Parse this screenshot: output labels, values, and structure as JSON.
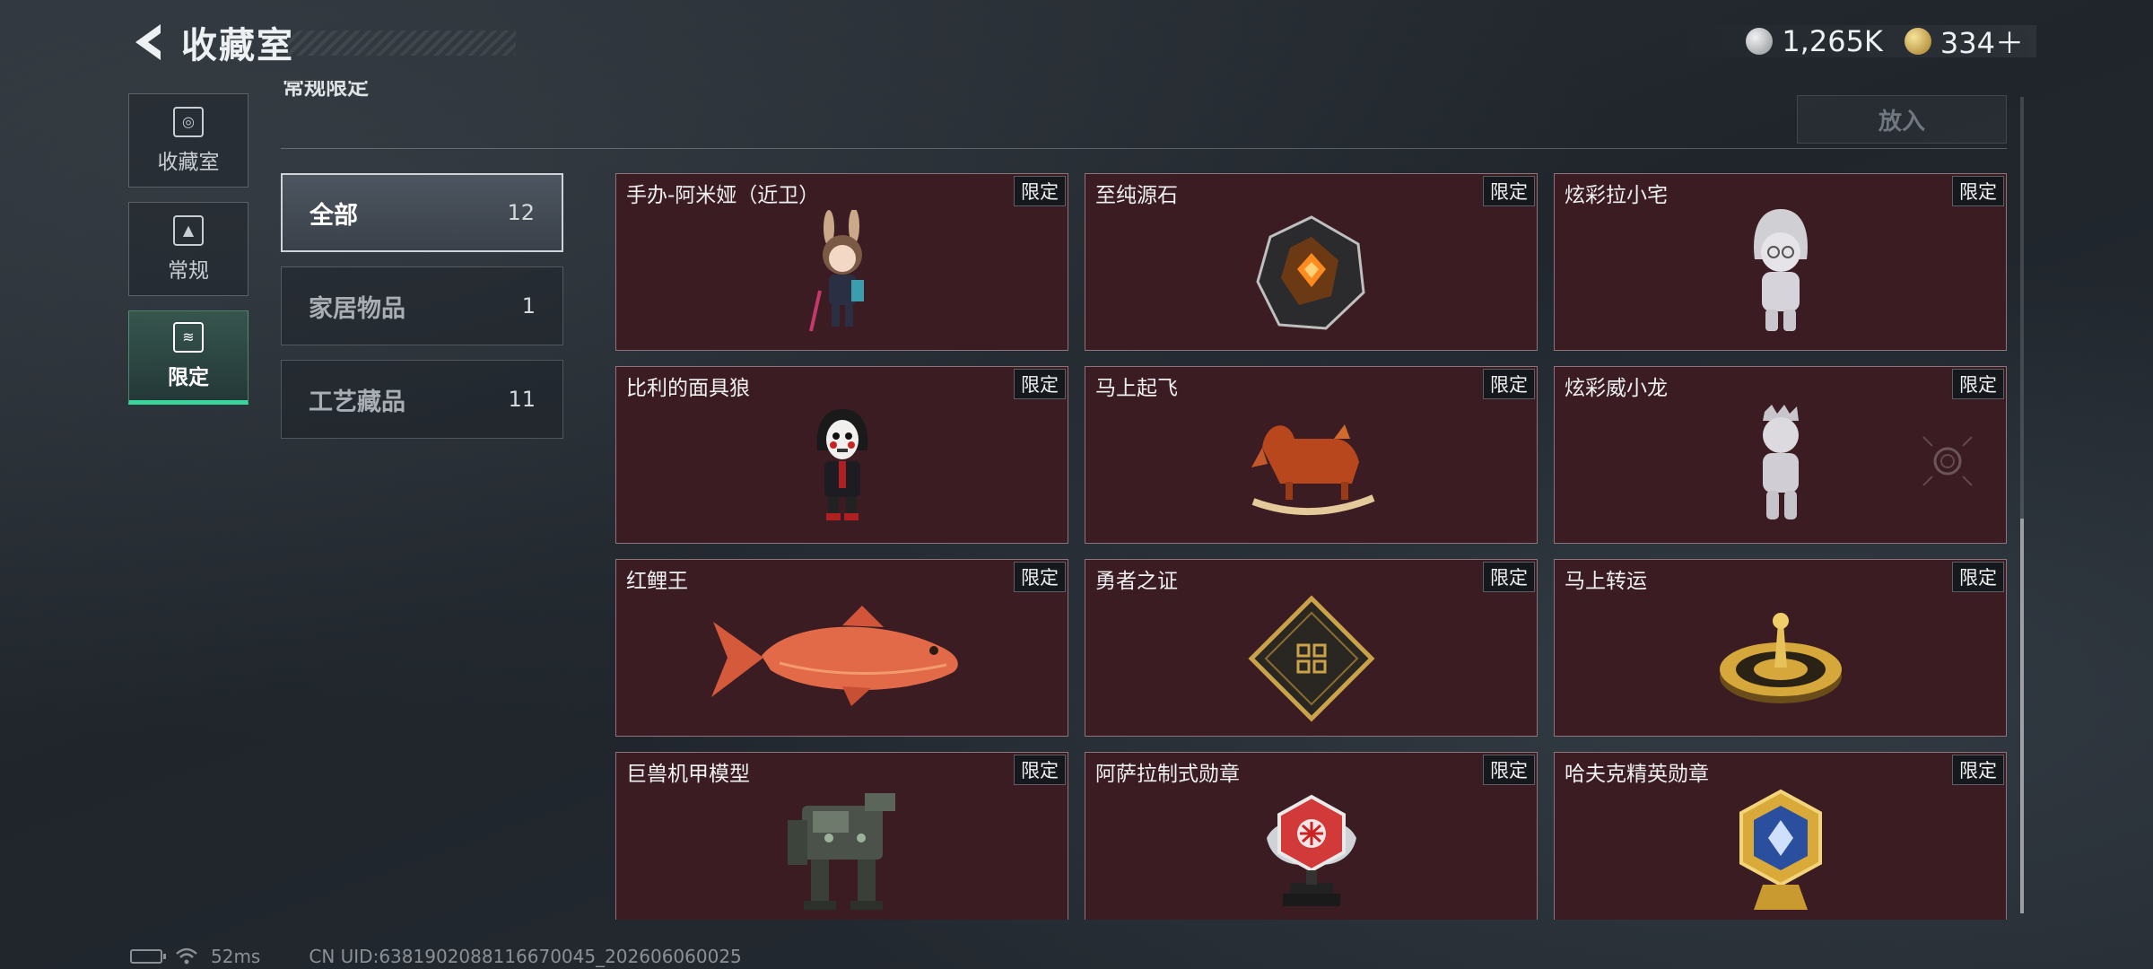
{
  "header": {
    "title": "收藏室"
  },
  "currency": {
    "silver": "1,265K",
    "gold": "334＋"
  },
  "nav": [
    {
      "label": "收藏室",
      "icon": "collection-icon"
    },
    {
      "label": "常规",
      "icon": "regular-icon"
    },
    {
      "label": "限定",
      "icon": "limited-icon",
      "active": true
    }
  ],
  "section": {
    "title": "常规限定",
    "put_label": "放入"
  },
  "categories": [
    {
      "name": "全部",
      "count": "12",
      "active": true
    },
    {
      "name": "家居物品",
      "count": "1"
    },
    {
      "name": "工艺藏品",
      "count": "11"
    }
  ],
  "badge": "限定",
  "items": [
    {
      "name": "手办-阿米娅（近卫）",
      "icon": "figure-amiya-icon"
    },
    {
      "name": "至纯源石",
      "icon": "originium-crystal-icon"
    },
    {
      "name": "炫彩拉小宅",
      "icon": "figure-white-icon"
    },
    {
      "name": "比利的面具狼",
      "icon": "mask-puppet-icon"
    },
    {
      "name": "马上起飞",
      "icon": "rocking-horse-icon"
    },
    {
      "name": "炫彩威小龙",
      "icon": "figure-dragon-icon"
    },
    {
      "name": "红鲤王",
      "icon": "red-carp-icon"
    },
    {
      "name": "勇者之证",
      "icon": "brave-card-icon"
    },
    {
      "name": "马上转运",
      "icon": "golden-wheel-icon"
    },
    {
      "name": "巨兽机甲模型",
      "icon": "mech-model-icon"
    },
    {
      "name": "阿萨拉制式勋章",
      "icon": "red-medal-icon"
    },
    {
      "name": "哈夫克精英勋章",
      "icon": "gold-medal-icon"
    }
  ],
  "status": {
    "ping": "52ms",
    "uid": "CN UID:6381902088116670045_202606060025"
  },
  "colors": {
    "card_bg": "#3a1c22",
    "active_tab": "#3ad39a"
  }
}
